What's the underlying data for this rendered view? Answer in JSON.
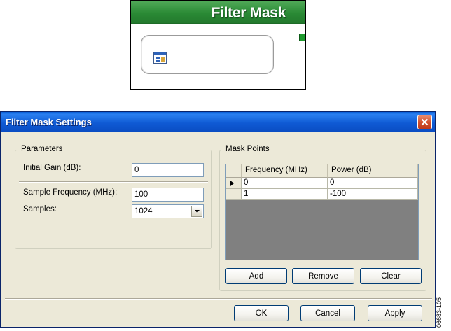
{
  "block": {
    "title": "Filter Mask"
  },
  "dialog": {
    "title": "Filter Mask Settings",
    "parameters": {
      "group_label": "Parameters",
      "initial_gain_label": "Initial Gain (dB):",
      "initial_gain_value": "0",
      "sample_freq_label": "Sample Frequency (MHz):",
      "sample_freq_value": "100",
      "samples_label": "Samples:",
      "samples_value": "1024"
    },
    "mask_points": {
      "group_label": "Mask Points",
      "columns": [
        "Frequency (MHz)",
        "Power (dB)"
      ],
      "rows": [
        {
          "frequency": "0",
          "power": "0"
        },
        {
          "frequency": "1",
          "power": "-100"
        }
      ],
      "add_label": "Add",
      "remove_label": "Remove",
      "clear_label": "Clear"
    },
    "footer": {
      "ok_label": "OK",
      "cancel_label": "Cancel",
      "apply_label": "Apply"
    }
  },
  "figure_id": "06683-105",
  "colors": {
    "titlebar": "#0a5fd8",
    "block_header": "#2a8a35",
    "dialog_bg": "#ece9d8",
    "grid_bg": "#808080"
  }
}
